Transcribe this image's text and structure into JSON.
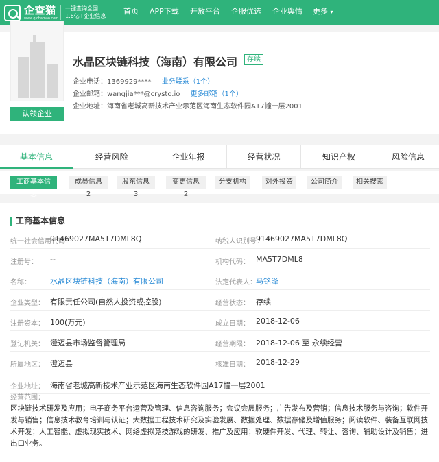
{
  "brand": {
    "name": "企查猫",
    "domain": "www.qichamao.com",
    "slogan_line1": "一键查询全国",
    "slogan_line2": "1.6亿+企业信息",
    "color": "#2fb37b"
  },
  "nav": [
    "首页",
    "APP下载",
    "开放平台",
    "企服优选",
    "企业舆情",
    "更多"
  ],
  "company": {
    "name": "水晶区块链科技（海南）有限公司",
    "status": "存续",
    "phone_label": "企业电话：",
    "phone": "1369929****",
    "phone_link": "业务联系（1个）",
    "email_label": "企业邮箱：",
    "email": "wangjia***@crysto.io",
    "email_link": "更多邮箱（1个）",
    "address_label": "企业地址：",
    "address": "海南省老城高新技术产业示范区海南生态软件园A17幢一层2001",
    "claim_label": "认领企业"
  },
  "tabs": [
    "基本信息",
    "经营风险",
    "企业年报",
    "经营状况",
    "知识产权",
    "风险信息"
  ],
  "subtabs": [
    "工商基本信息",
    "成员信息 2",
    "股东信息 3",
    "变更信息 2",
    "分支机构",
    "对外投资",
    "公司简介",
    "相关搜索"
  ],
  "section": {
    "title": "工商基本信息",
    "left": [
      {
        "label": "统一社会信用代码：",
        "value": "91469027MA5T7DML8Q"
      },
      {
        "label": "注册号：",
        "value": "--"
      },
      {
        "label": "名称：",
        "value": "水晶区块链科技（海南）有限公司"
      },
      {
        "label": "企业类型：",
        "value": "有限责任公司(自然人投资或控股)"
      },
      {
        "label": "注册资本：",
        "value": "100(万元)"
      },
      {
        "label": "登记机关：",
        "value": "澄迈县市场监督管理局"
      },
      {
        "label": "所属地区：",
        "value": "澄迈县"
      }
    ],
    "right": [
      {
        "label": "纳税人识别号：",
        "value": "91469027MA5T7DML8Q"
      },
      {
        "label": "机构代码：",
        "value": "MA5T7DML8"
      },
      {
        "label": "法定代表人：",
        "value": "马铭泽"
      },
      {
        "label": "经营状态：",
        "value": "存续"
      },
      {
        "label": "成立日期：",
        "value": "2018-12-06"
      },
      {
        "label": "经营期限：",
        "value": "2018-12-06 至 永续经营"
      },
      {
        "label": "核准日期：",
        "value": "2018-12-29"
      }
    ],
    "address_label": "企业地址：",
    "address": "海南省老城高新技术产业示范区海南生态软件园A17幢一层2001",
    "scope_label": "经营范围：",
    "scope": "区块链技术研发及应用；电子商务平台运营及管理、信息咨询服务；会议会展服务；广告发布及营销；信息技术服务与咨询；软件开发与销售；信息技术教育培训与认证；大数据工程技术研究及实验发展、数据处理、数据存储及增值服务；阅读软件、装备互联网技术开发；人工智能、虚拟现实技术、网络虚拟竞技游戏的研发、推广及应用；软硬件开发、代理、转让、咨询、辅助设计及销售；进出口业务。"
  }
}
